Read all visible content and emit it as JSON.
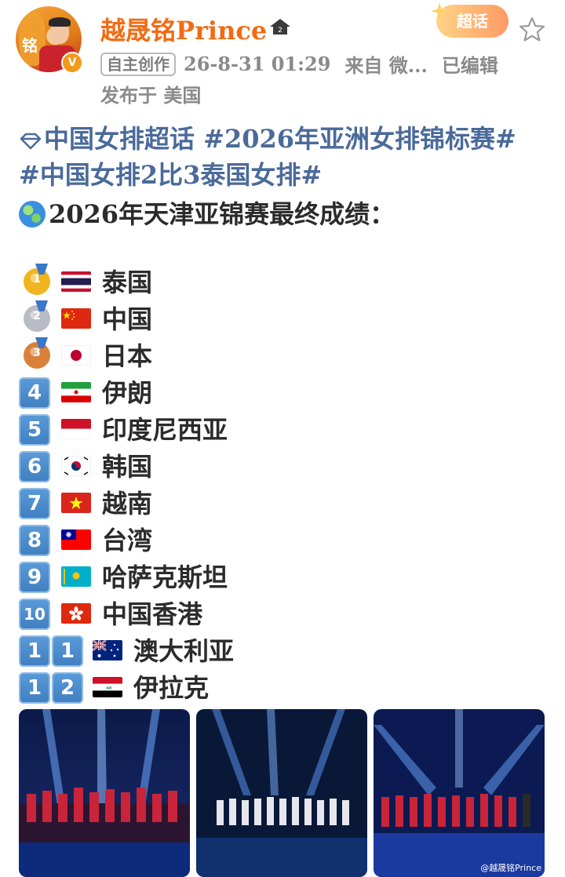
{
  "header": {
    "username": "越晟铭Prince",
    "avatar_text": "铭",
    "verified_badge": "V",
    "supertopic_button": "超话",
    "meta": {
      "tag": "自主创作",
      "timestamp": "26-8-31 01:29",
      "source": "来自 微...",
      "edited": "已编辑"
    },
    "location": "发布于 美国"
  },
  "post": {
    "topic_line_1": "中国女排超话   #2026年亚洲女排锦标赛#",
    "topic_line_2": "#中国女排2比3泰国女排#",
    "headline": "2026年天津亚锦赛最终成绩："
  },
  "rankings": [
    {
      "rank": "1",
      "badge": "gold-medal",
      "flag": "thailand",
      "country": "泰国"
    },
    {
      "rank": "2",
      "badge": "silver-medal",
      "flag": "china",
      "country": "中国"
    },
    {
      "rank": "3",
      "badge": "bronze-medal",
      "flag": "japan",
      "country": "日本"
    },
    {
      "rank": "4",
      "badge": "keycap",
      "flag": "iran",
      "country": "伊朗"
    },
    {
      "rank": "5",
      "badge": "keycap",
      "flag": "indonesia",
      "country": "印度尼西亚"
    },
    {
      "rank": "6",
      "badge": "keycap",
      "flag": "south-korea",
      "country": "韩国"
    },
    {
      "rank": "7",
      "badge": "keycap",
      "flag": "vietnam",
      "country": "越南"
    },
    {
      "rank": "8",
      "badge": "keycap",
      "flag": "taiwan",
      "country": "台湾"
    },
    {
      "rank": "9",
      "badge": "keycap",
      "flag": "kazakhstan",
      "country": "哈萨克斯坦"
    },
    {
      "rank": "10",
      "badge": "keycap",
      "flag": "hong-kong",
      "country": "中国香港"
    },
    {
      "rank": "11",
      "badge": "keycap-pair",
      "flag": "australia",
      "country": "澳大利亚"
    },
    {
      "rank": "12",
      "badge": "keycap-pair",
      "flag": "iraq",
      "country": "伊拉克"
    }
  ],
  "photos": {
    "watermark": "@越晟铭Prince",
    "images": [
      "podium-thailand-celebration",
      "stage-lineup-team",
      "stage-lineup-lights"
    ]
  },
  "colors": {
    "username": "#f26b13",
    "topic": "#4a6a9a",
    "keycap": "#4a8bcc"
  }
}
